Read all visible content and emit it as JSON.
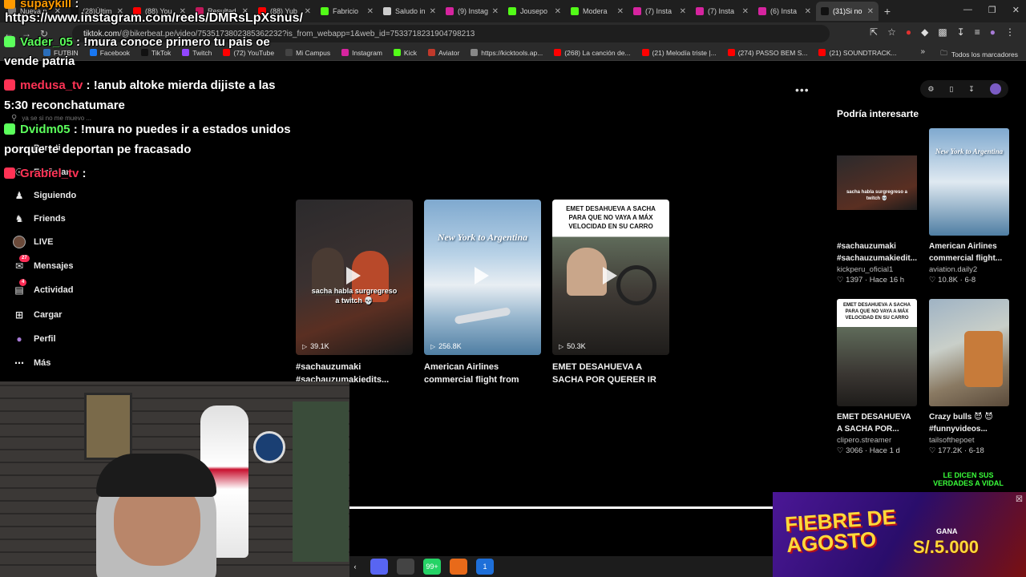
{
  "browser": {
    "tabs": [
      {
        "label": "Nueva p",
        "color": "#7a7a7a"
      },
      {
        "label": "(28)Últim",
        "color": "#111111"
      },
      {
        "label": "(88) You",
        "color": "#ff0000"
      },
      {
        "label": "Resultad",
        "color": "#c2185b"
      },
      {
        "label": "(88) Yub",
        "color": "#ff0000"
      },
      {
        "label": "Fabricio",
        "color": "#53fc18"
      },
      {
        "label": "Saludo in",
        "color": "#cccccc"
      },
      {
        "label": "(9) Instag",
        "color": "#d6249f"
      },
      {
        "label": "Jousepo",
        "color": "#53fc18"
      },
      {
        "label": "Modera",
        "color": "#53fc18"
      },
      {
        "label": "(7) Insta",
        "color": "#d6249f"
      },
      {
        "label": "(7) Insta",
        "color": "#d6249f"
      },
      {
        "label": "(6) Insta",
        "color": "#d6249f"
      },
      {
        "label": "(31)Si no",
        "color": "#111111",
        "active": true
      }
    ],
    "new_tab": "+",
    "address": {
      "host": "tiktok.com",
      "path": "/@bikerbeat.pe/video/7535173802385362232?is_from_webapp=1&web_id=7533718231904798213"
    },
    "bookmarks": [
      {
        "label": "FUTBIN",
        "color": "#2a6ebb"
      },
      {
        "label": "Facebook",
        "color": "#1877f2"
      },
      {
        "label": "TikTok",
        "color": "#111111"
      },
      {
        "label": "Twitch",
        "color": "#9146ff"
      },
      {
        "label": "(72) YouTube",
        "color": "#ff0000"
      },
      {
        "label": "Mi Campus",
        "color": "#444444"
      },
      {
        "label": "Instagram",
        "color": "#d6249f"
      },
      {
        "label": "Kick",
        "color": "#53fc18"
      },
      {
        "label": "Aviator",
        "color": "#c0392b"
      },
      {
        "label": "https://kicktools.ap...",
        "color": "#888888"
      },
      {
        "label": "(268) La canción de...",
        "color": "#ff0000"
      },
      {
        "label": "(21) Melodía triste |...",
        "color": "#ff0000"
      },
      {
        "label": "(274) PASSO BEM S...",
        "color": "#ff0000"
      },
      {
        "label": "(21) SOUNDTRACK...",
        "color": "#ff0000"
      }
    ],
    "bookmarks_more": "»",
    "all_bookmarks": "Todos los marcadores"
  },
  "overlay": {
    "url": "https://www.instagram.com/reels/DMRsLpXsnus/",
    "chat": [
      {
        "user": "supaykill",
        "text": " :",
        "user_color": "#ff9a00"
      },
      {
        "user": "Vader_05",
        "text": " : !mura conoce primero tu pais oe",
        "user_color": "#5cff5c"
      },
      {
        "user": "",
        "text": "vende patria",
        "user_color": "#ffffff"
      },
      {
        "user": "medusa_tv",
        "text": " : !anub altoke mierda dijiste a las",
        "user_color": "#ff3355"
      },
      {
        "user": "",
        "text": "5:30 reconchatumare",
        "user_color": "#ffffff"
      },
      {
        "user": "Dvidm05",
        "text": " : !mura no puedes ir a estados unidos",
        "user_color": "#5cff5c"
      },
      {
        "user": "",
        "text": "porque te deportan pe fracasado",
        "user_color": "#ffffff"
      },
      {
        "user": "Grabiel_tv",
        "text": " :",
        "user_color": "#ff3355"
      }
    ]
  },
  "tiktok": {
    "search_placeholder": "ya se si no me muevo ...",
    "nav": [
      {
        "label": "Para ti",
        "icon": "home-icon"
      },
      {
        "label": "Explorar",
        "icon": "compass-icon"
      },
      {
        "label": "Siguiendo",
        "icon": "following-icon"
      },
      {
        "label": "Friends",
        "icon": "friends-icon"
      },
      {
        "label": "LIVE",
        "icon": "live-icon"
      },
      {
        "label": "Mensajes",
        "icon": "messages-icon",
        "badge": "27"
      },
      {
        "label": "Actividad",
        "icon": "activity-icon",
        "badge": "4"
      },
      {
        "label": "Cargar",
        "icon": "upload-icon"
      },
      {
        "label": "Perfil",
        "icon": "profile-icon"
      },
      {
        "label": "Más",
        "icon": "more-icon"
      }
    ],
    "more_menu": "•••",
    "videos": [
      {
        "views": "39.1K",
        "title": "#sachauzumaki #sachauzumakiedits...",
        "caption": "sacha habla surgregreso a twitch 💀"
      },
      {
        "views": "256.8K",
        "title": "American Airlines commercial flight from New...",
        "caption": "New York to Argentina"
      },
      {
        "views": "50.3K",
        "title": "EMET DESAHUEVA A SACHA POR QUERER IR RÁPIDO E...",
        "caption": "EMET DESAHUEVA A SACHA PARA QUE NO VAYA A MÁX VELOCIDAD EN SU CARRO"
      }
    ],
    "suggested": {
      "heading": "Podría interesarte",
      "items": [
        {
          "title": "#sachauzumaki #sachauzumakiedit...",
          "author": "kickperu_oficial1",
          "likes": "1397",
          "time": "Hace 16 h",
          "caption": "sacha habla surgregreso a twitch 💀"
        },
        {
          "title": "American Airlines commercial flight...",
          "author": "aviation.daily2",
          "likes": "10.8K",
          "time": "6-8",
          "caption": "New York to Argentina"
        },
        {
          "title": "EMET DESAHUEVA A SACHA POR...",
          "author": "clipero.streamer",
          "likes": "3066",
          "time": "Hace 1 d",
          "caption": "EMET DESAHUEVA A SACHA PARA QUE NO VAYA A MÁX VELOCIDAD EN SU CARRO"
        },
        {
          "title": "Crazy bulls 😈 😈 #funnyvideos...",
          "author": "tailsofthepoet",
          "likes": "177.2K",
          "time": "6-18",
          "caption": ""
        }
      ]
    }
  },
  "banner": {
    "title": "FIEBRE DE AGOSTO",
    "gana": "GANA",
    "amount": "S/.5.000",
    "verdades": "LE DICEN SUS VERDADES A VIDAL"
  },
  "taskbar": {
    "icons": [
      {
        "name": "discord-icon",
        "color": "#5865f2",
        "label": ""
      },
      {
        "name": "tool-icon",
        "color": "#444444",
        "label": ""
      },
      {
        "name": "whatsapp-icon",
        "color": "#25d366",
        "label": "99+"
      },
      {
        "name": "obs-icon",
        "color": "#e86a1a",
        "label": ""
      },
      {
        "name": "app-icon",
        "color": "#1e6fd9",
        "label": "1"
      }
    ]
  }
}
